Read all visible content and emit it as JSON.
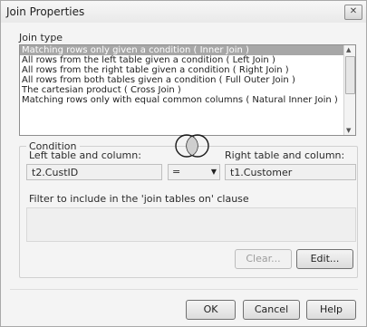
{
  "window": {
    "title": "Join Properties",
    "close_icon": "✕"
  },
  "join_type": {
    "label": "Join type",
    "options": [
      "Matching rows only given a condition ( Inner Join )",
      "All rows from the left table given a condition ( Left Join )",
      "All rows from the right table given a condition ( Right Join )",
      "All rows from both tables given a condition ( Full Outer Join )",
      "The cartesian product ( Cross Join )",
      "Matching rows only with equal common columns ( Natural Inner Join )"
    ],
    "selected": "Matching rows only given a condition ( Inner Join )"
  },
  "condition": {
    "group_label": "Condition",
    "left_label": "Left table and column:",
    "left_value": "t2.CustID",
    "operator": "=",
    "right_label": "Right table and column:",
    "right_value": "t1.Customer",
    "venn_icon": "venn-diagram-icon",
    "filter_label": "Filter to include in the 'join tables on' clause",
    "filter_value": "",
    "clear_label": "Clear...",
    "edit_label": "Edit..."
  },
  "footer": {
    "ok_label": "OK",
    "cancel_label": "Cancel",
    "help_label": "Help"
  },
  "colors": {
    "selection": "#a7a7a7",
    "window_bg": "#f4f4f4"
  }
}
